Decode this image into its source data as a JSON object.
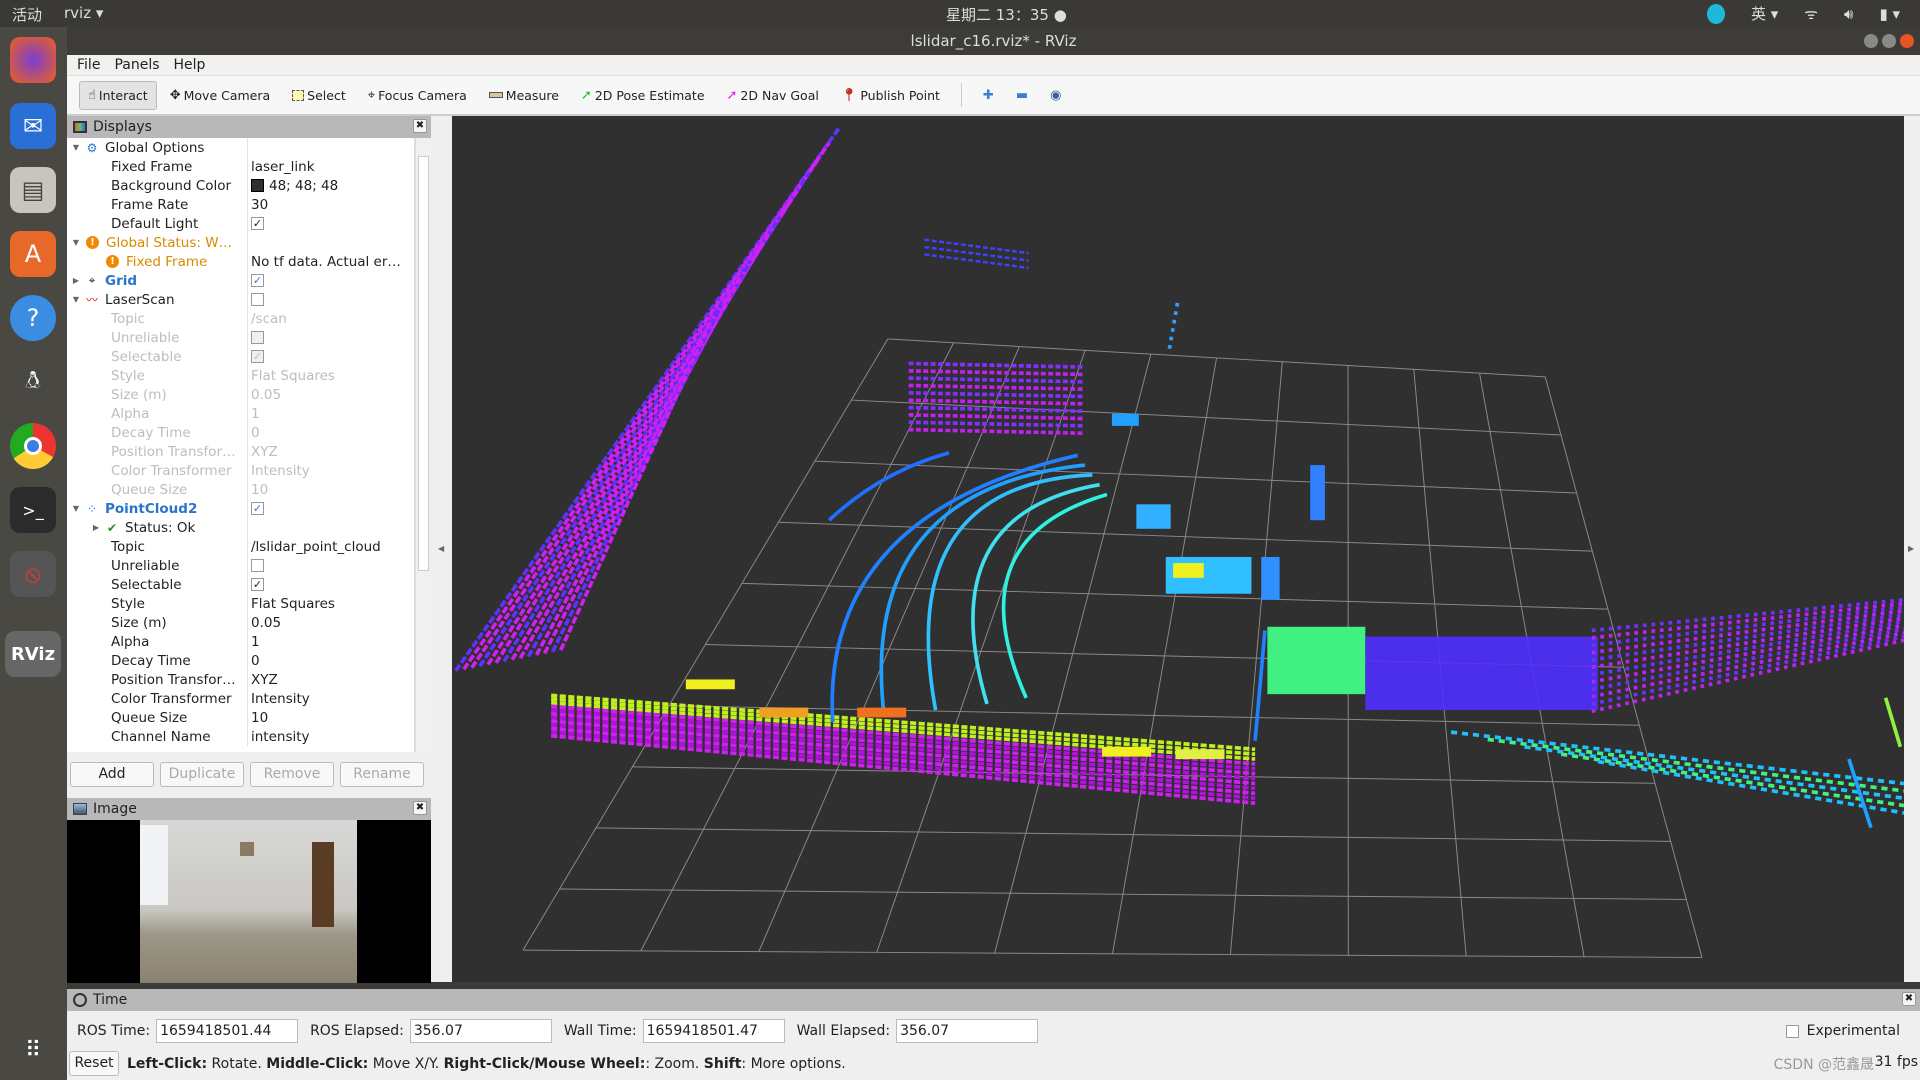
{
  "topbar": {
    "activities": "活动",
    "app": "rviz ▾",
    "clock": "星期二 13：35 ●",
    "input_method": "英 ▾",
    "tray": [
      "wifi-icon",
      "volume-icon",
      "battery-icon"
    ]
  },
  "window": {
    "title": "lslidar_c16.rviz* - RViz"
  },
  "menu": [
    "File",
    "Panels",
    "Help"
  ],
  "toolbar": [
    {
      "label": "Interact",
      "icon": "hand-icon",
      "active": true
    },
    {
      "label": "Move Camera",
      "icon": "move-camera-icon"
    },
    {
      "label": "Select",
      "icon": "select-icon"
    },
    {
      "label": "Focus Camera",
      "icon": "focus-camera-icon"
    },
    {
      "label": "Measure",
      "icon": "ruler-icon"
    },
    {
      "label": "2D Pose Estimate",
      "icon": "green-arrow-icon",
      "color": "#22c022"
    },
    {
      "label": "2D Nav Goal",
      "icon": "magenta-arrow-icon",
      "color": "#e020e0"
    },
    {
      "label": "Publish Point",
      "icon": "map-pin-icon",
      "color": "#c0301c"
    }
  ],
  "displays": {
    "title": "Displays",
    "rows": [
      {
        "indent": 0,
        "arrow": "▼",
        "icon": "⚙",
        "label": "Global Options",
        "value": "",
        "cls": ""
      },
      {
        "indent": 1,
        "label": "Fixed Frame",
        "value": "laser_link"
      },
      {
        "indent": 1,
        "label": "Background Color",
        "value": "48; 48; 48",
        "swatch": "#303030"
      },
      {
        "indent": 1,
        "label": "Frame Rate",
        "value": "30"
      },
      {
        "indent": 1,
        "label": "Default Light",
        "check": true
      },
      {
        "indent": 0,
        "arrow": "▼",
        "icon": "!",
        "label": "Global Status: W…",
        "cls": "warn"
      },
      {
        "indent": 1,
        "icon": "!",
        "label": "Fixed Frame",
        "value": "No tf data.  Actual er…",
        "cls": "warn"
      },
      {
        "indent": 0,
        "arrow": "▶",
        "icon": "⌖",
        "label": "Grid",
        "check": true,
        "cls": "blue"
      },
      {
        "indent": 0,
        "arrow": "▼",
        "icon": "〰",
        "label": "LaserScan",
        "check": false
      },
      {
        "indent": 1,
        "label": "Topic",
        "value": "/scan",
        "cls": "dis"
      },
      {
        "indent": 1,
        "label": "Unreliable",
        "check": false,
        "cls": "dis"
      },
      {
        "indent": 1,
        "label": "Selectable",
        "check": true,
        "cls": "dis"
      },
      {
        "indent": 1,
        "label": "Style",
        "value": "Flat Squares",
        "cls": "dis"
      },
      {
        "indent": 1,
        "label": "Size (m)",
        "value": "0.05",
        "cls": "dis"
      },
      {
        "indent": 1,
        "label": "Alpha",
        "value": "1",
        "cls": "dis"
      },
      {
        "indent": 1,
        "label": "Decay Time",
        "value": "0",
        "cls": "dis"
      },
      {
        "indent": 1,
        "label": "Position Transfor…",
        "value": "XYZ",
        "cls": "dis"
      },
      {
        "indent": 1,
        "label": "Color Transformer",
        "value": "Intensity",
        "cls": "dis"
      },
      {
        "indent": 1,
        "label": "Queue Size",
        "value": "10",
        "cls": "dis"
      },
      {
        "indent": 0,
        "arrow": "▼",
        "icon": "⁘",
        "label": "PointCloud2",
        "check": true,
        "cls": "blue"
      },
      {
        "indent": 1,
        "arrow": "▶",
        "icon": "✔",
        "label": "Status: Ok"
      },
      {
        "indent": 1,
        "label": "Topic",
        "value": "/lslidar_point_cloud"
      },
      {
        "indent": 1,
        "label": "Unreliable",
        "check": false
      },
      {
        "indent": 1,
        "label": "Selectable",
        "check": true
      },
      {
        "indent": 1,
        "label": "Style",
        "value": "Flat Squares"
      },
      {
        "indent": 1,
        "label": "Size (m)",
        "value": "0.05"
      },
      {
        "indent": 1,
        "label": "Alpha",
        "value": "1"
      },
      {
        "indent": 1,
        "label": "Decay Time",
        "value": "0"
      },
      {
        "indent": 1,
        "label": "Position Transfor…",
        "value": "XYZ"
      },
      {
        "indent": 1,
        "label": "Color Transformer",
        "value": "Intensity"
      },
      {
        "indent": 1,
        "label": "Queue Size",
        "value": "10"
      },
      {
        "indent": 1,
        "label": "Channel Name",
        "value": "intensity"
      }
    ],
    "buttons": {
      "add": "Add",
      "duplicate": "Duplicate",
      "remove": "Remove",
      "rename": "Rename"
    }
  },
  "image_panel": {
    "title": "Image"
  },
  "time": {
    "title": "Time",
    "ros_time_label": "ROS Time:",
    "ros_time": "1659418501.44",
    "ros_elapsed_label": "ROS Elapsed:",
    "ros_elapsed": "356.07",
    "wall_time_label": "Wall Time:",
    "wall_time": "1659418501.47",
    "wall_elapsed_label": "Wall Elapsed:",
    "wall_elapsed": "356.07",
    "experimental": "Experimental",
    "reset": "Reset",
    "hint": [
      {
        "b": "Left-Click:",
        "t": "Rotate."
      },
      {
        "b": "Middle-Click:",
        "t": "Move X/Y."
      },
      {
        "b": "Right-Click/Mouse Wheel:",
        "t": ": Zoom."
      },
      {
        "b": "Shift",
        "t": ": More options."
      }
    ],
    "fps": "31 fps",
    "watermark": "CSDN @范鑫晟"
  }
}
